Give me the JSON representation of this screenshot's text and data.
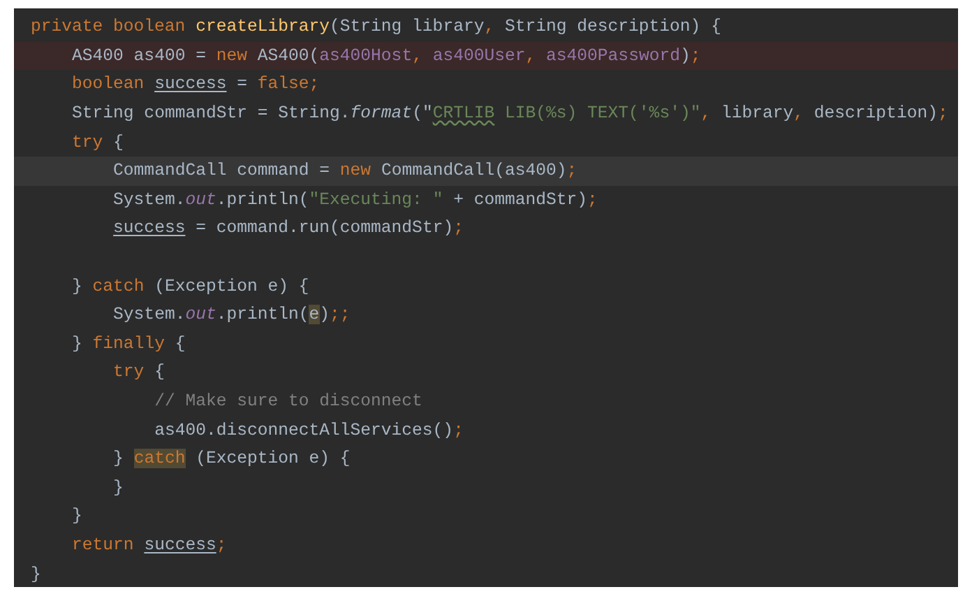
{
  "editor": {
    "lines": [
      {
        "error": false,
        "caret": false,
        "tokens": [
          {
            "t": "private boolean ",
            "kind": "keyword"
          },
          {
            "t": "createLibrary",
            "kind": "declaration"
          },
          {
            "t": "(String library",
            "kind": "plain"
          },
          {
            "t": ", ",
            "kind": "punctuation"
          },
          {
            "t": "String description) {",
            "kind": "plain"
          }
        ]
      },
      {
        "error": true,
        "caret": false,
        "tokens": [
          {
            "t": "    AS400 as400 = ",
            "kind": "plain"
          },
          {
            "t": "new ",
            "kind": "keyword"
          },
          {
            "t": "AS400(",
            "kind": "plain"
          },
          {
            "t": "as400Host",
            "kind": "field"
          },
          {
            "t": ", ",
            "kind": "punctuation"
          },
          {
            "t": "as400User",
            "kind": "field"
          },
          {
            "t": ", ",
            "kind": "punctuation"
          },
          {
            "t": "as400Password",
            "kind": "field"
          },
          {
            "t": ")",
            "kind": "plain"
          },
          {
            "t": ";",
            "kind": "punctuation"
          }
        ]
      },
      {
        "error": false,
        "caret": false,
        "tokens": [
          {
            "t": "    boolean ",
            "kind": "keyword"
          },
          {
            "t": "success",
            "kind": "plain",
            "underline": true
          },
          {
            "t": " = ",
            "kind": "plain"
          },
          {
            "t": "false;",
            "kind": "keyword"
          }
        ]
      },
      {
        "error": false,
        "caret": false,
        "tokens": [
          {
            "t": "    String commandStr = String.",
            "kind": "plain"
          },
          {
            "t": "format",
            "kind": "italic"
          },
          {
            "t": "(\"",
            "kind": "plain"
          },
          {
            "t": "CRTLIB",
            "kind": "string",
            "typo": true
          },
          {
            "t": " LIB(%s) TEXT('%s')\"",
            "kind": "string"
          },
          {
            "t": ", ",
            "kind": "punctuation"
          },
          {
            "t": "library",
            "kind": "plain"
          },
          {
            "t": ", ",
            "kind": "punctuation"
          },
          {
            "t": "description)",
            "kind": "plain"
          },
          {
            "t": ";",
            "kind": "punctuation"
          }
        ]
      },
      {
        "error": false,
        "caret": false,
        "tokens": [
          {
            "t": "    try ",
            "kind": "keyword"
          },
          {
            "t": "{",
            "kind": "plain"
          }
        ]
      },
      {
        "error": false,
        "caret": true,
        "tokens": [
          {
            "t": "        CommandCall command = ",
            "kind": "plain"
          },
          {
            "t": "new ",
            "kind": "keyword"
          },
          {
            "t": "CommandCall(as400)",
            "kind": "plain"
          },
          {
            "t": ";",
            "kind": "punctuation"
          }
        ]
      },
      {
        "error": false,
        "caret": false,
        "tokens": [
          {
            "t": "        System.",
            "kind": "plain"
          },
          {
            "t": "out",
            "kind": "static"
          },
          {
            "t": ".println(",
            "kind": "plain"
          },
          {
            "t": "\"Executing: \"",
            "kind": "string"
          },
          {
            "t": " + commandStr)",
            "kind": "plain"
          },
          {
            "t": ";",
            "kind": "punctuation"
          }
        ]
      },
      {
        "error": false,
        "caret": false,
        "tokens": [
          {
            "t": "        success",
            "kind": "plain",
            "underline": true
          },
          {
            "t": " = command.run(commandStr)",
            "kind": "plain"
          },
          {
            "t": ";",
            "kind": "punctuation"
          }
        ]
      },
      {
        "error": false,
        "caret": false
      },
      {
        "error": false,
        "caret": false,
        "tokens": [
          {
            "t": "    } ",
            "kind": "plain"
          },
          {
            "t": "catch ",
            "kind": "keyword"
          },
          {
            "t": "(Exception e) {",
            "kind": "plain"
          }
        ]
      },
      {
        "error": false,
        "caret": false,
        "tokens": [
          {
            "t": "        System.",
            "kind": "plain"
          },
          {
            "t": "out",
            "kind": "static"
          },
          {
            "t": ".println(",
            "kind": "plain"
          },
          {
            "t": "e",
            "kind": "plain",
            "match": true
          },
          {
            "t": ")",
            "kind": "plain"
          },
          {
            "t": ";;",
            "kind": "punctuation"
          }
        ]
      },
      {
        "error": false,
        "caret": false,
        "tokens": [
          {
            "t": "    } ",
            "kind": "plain"
          },
          {
            "t": "finally ",
            "kind": "keyword"
          },
          {
            "t": "{",
            "kind": "plain"
          }
        ]
      },
      {
        "error": false,
        "caret": false,
        "tokens": [
          {
            "t": "        try ",
            "kind": "keyword"
          },
          {
            "t": "{",
            "kind": "plain"
          }
        ]
      },
      {
        "error": false,
        "caret": false,
        "tokens": [
          {
            "t": "            // Make sure to disconnect",
            "kind": "comment"
          }
        ]
      },
      {
        "error": false,
        "caret": false,
        "tokens": [
          {
            "t": "            as400.disconnectAllServices()",
            "kind": "plain"
          },
          {
            "t": ";",
            "kind": "punctuation"
          }
        ]
      },
      {
        "error": false,
        "caret": false,
        "tokens": [
          {
            "t": "        } ",
            "kind": "plain"
          },
          {
            "t": "catch",
            "kind": "keyword",
            "match": true
          },
          {
            "t": " (Exception e) {",
            "kind": "plain"
          }
        ]
      },
      {
        "error": false,
        "caret": false,
        "tokens": [
          {
            "t": "        }",
            "kind": "plain"
          }
        ]
      },
      {
        "error": false,
        "caret": false,
        "tokens": [
          {
            "t": "    }",
            "kind": "plain"
          }
        ]
      },
      {
        "error": false,
        "caret": false,
        "tokens": [
          {
            "t": "    return ",
            "kind": "keyword"
          },
          {
            "t": "success",
            "kind": "plain",
            "underline": true
          },
          {
            "t": ";",
            "kind": "punctuation"
          }
        ]
      },
      {
        "error": false,
        "caret": false,
        "tokens": [
          {
            "t": "}",
            "kind": "plain"
          }
        ]
      }
    ]
  }
}
